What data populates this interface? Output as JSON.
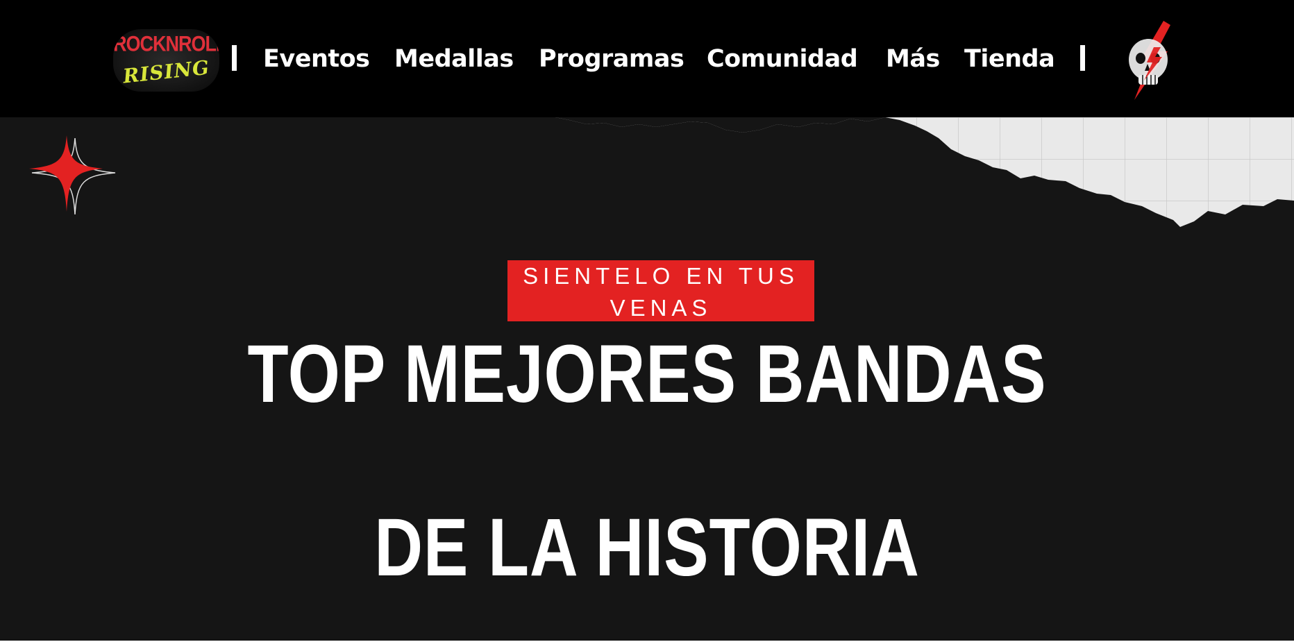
{
  "header": {
    "logo": {
      "line1": "ROCKNROLL",
      "line2": "RISING",
      "icon": "rocknroll-rising-logo"
    },
    "separator": "|",
    "nav_items": [
      {
        "label": "Eventos"
      },
      {
        "label": "Medallas"
      },
      {
        "label": "Programas"
      },
      {
        "label": "Comunidad"
      },
      {
        "label": "Más"
      },
      {
        "label": "Tienda"
      }
    ],
    "profile_icon": "skull-lightning-icon"
  },
  "hero": {
    "tagline": "SIENTELO EN TUS VENAS",
    "title_line1": "TOP MEJORES BANDAS",
    "title_line2": "DE LA HISTORIA",
    "decoration_icon": "sparkle-star-icon"
  },
  "colors": {
    "header_bg": "#000000",
    "hero_bg": "#151515",
    "accent_red": "#e32222",
    "logo_yellow": "#d8e63a",
    "text": "#ffffff"
  }
}
